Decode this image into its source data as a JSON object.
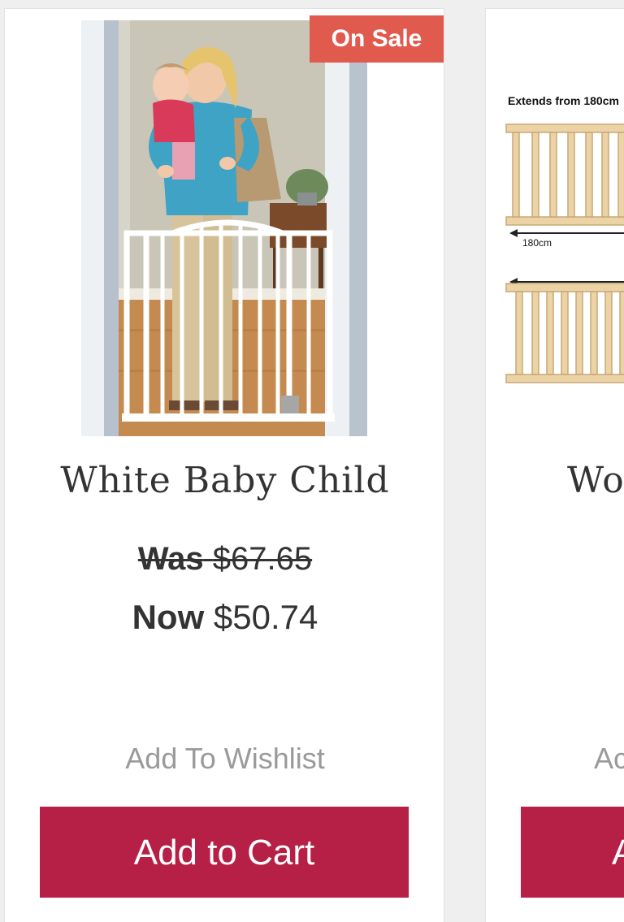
{
  "products": [
    {
      "badge": "On Sale",
      "image_icon": "baby-gate-photo",
      "title": "White Baby Child",
      "price_was_label": "Was",
      "price_was_value": "$67.65",
      "price_now_label": "Now",
      "price_now_value": "$50.74",
      "wishlist_label": "Add To Wishlist",
      "cart_label": "Add to Cart"
    },
    {
      "image_icon": "wooden-gate-photo",
      "image_caption": "Extends from 180cm",
      "image_measure": "180cm",
      "title": "Wo",
      "wishlist_label": "Ac",
      "cart_label": "A"
    }
  ],
  "colors": {
    "badge": "#e05a4e",
    "cart_button": "#b62046",
    "wishlist_text": "#9a9a9a",
    "title_text": "#333333"
  }
}
